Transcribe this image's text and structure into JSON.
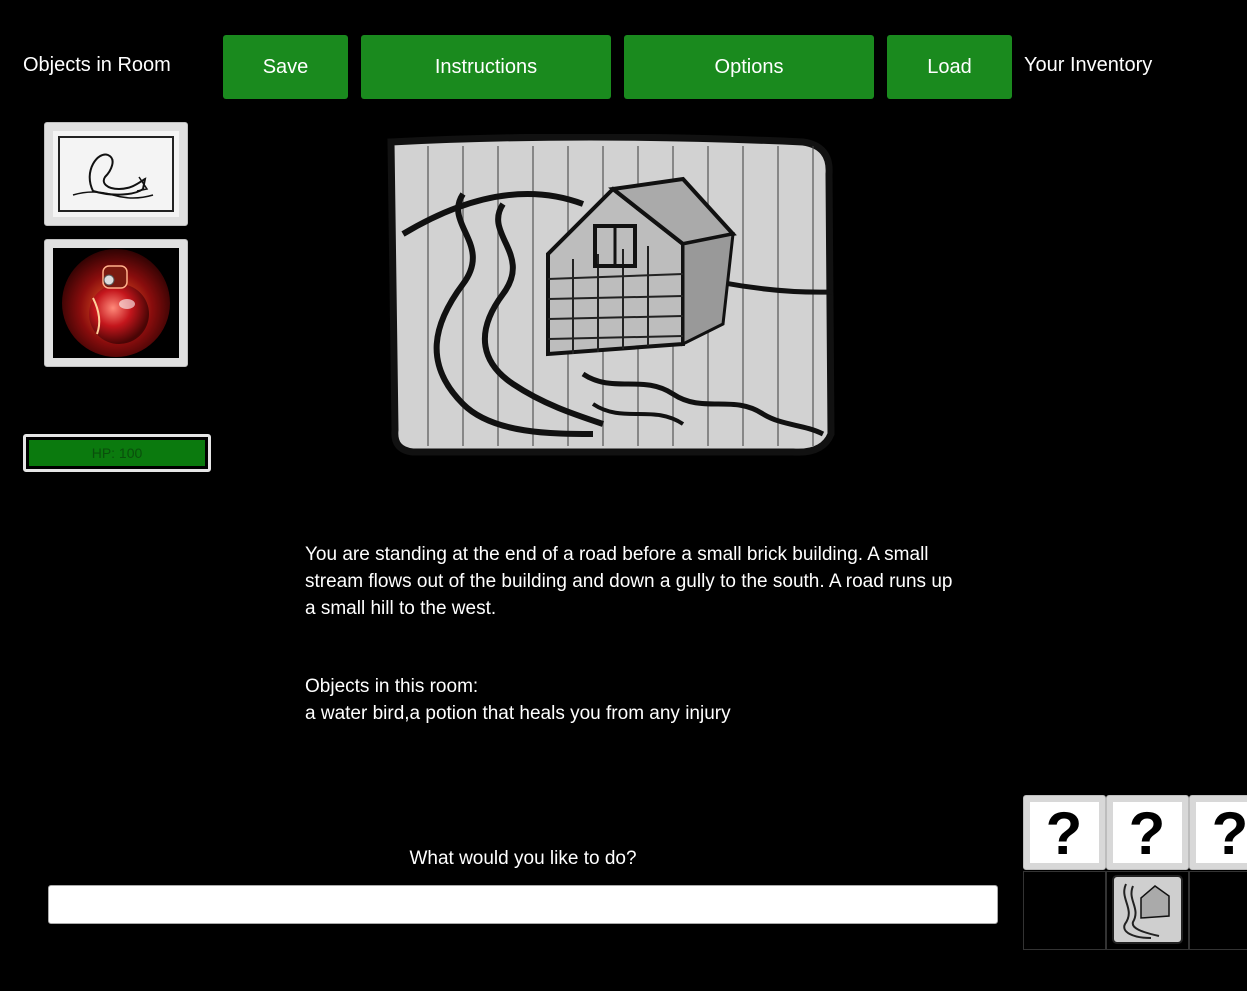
{
  "header": {
    "objects_label": "Objects in Room",
    "inventory_label": "Your Inventory",
    "buttons": {
      "save": "Save",
      "instructions": "Instructions",
      "options": "Options",
      "load": "Load"
    },
    "button_color": "#1a8a1e"
  },
  "room_objects": [
    {
      "name": "water bird",
      "icon": "swan-sketch-icon"
    },
    {
      "name": "healing potion",
      "icon": "red-potion-icon"
    }
  ],
  "status": {
    "hp_text": "HP: 100",
    "hp_fraction": 1.0
  },
  "scene": {
    "description": "You are standing at the end of a road before a small brick building.  A small stream flows out of the building and down a gully to the south.  A road runs up a small hill to the west.",
    "objects_heading": "Objects in this room:",
    "objects_list": "a water bird,a potion that heals you from any injury"
  },
  "command": {
    "prompt": "What would you like to do?",
    "value": ""
  },
  "inventory": {
    "slots": [
      "question-mark-icon",
      "question-mark-icon",
      "question-mark-icon"
    ],
    "map_icon": "map-sketch-icon"
  }
}
